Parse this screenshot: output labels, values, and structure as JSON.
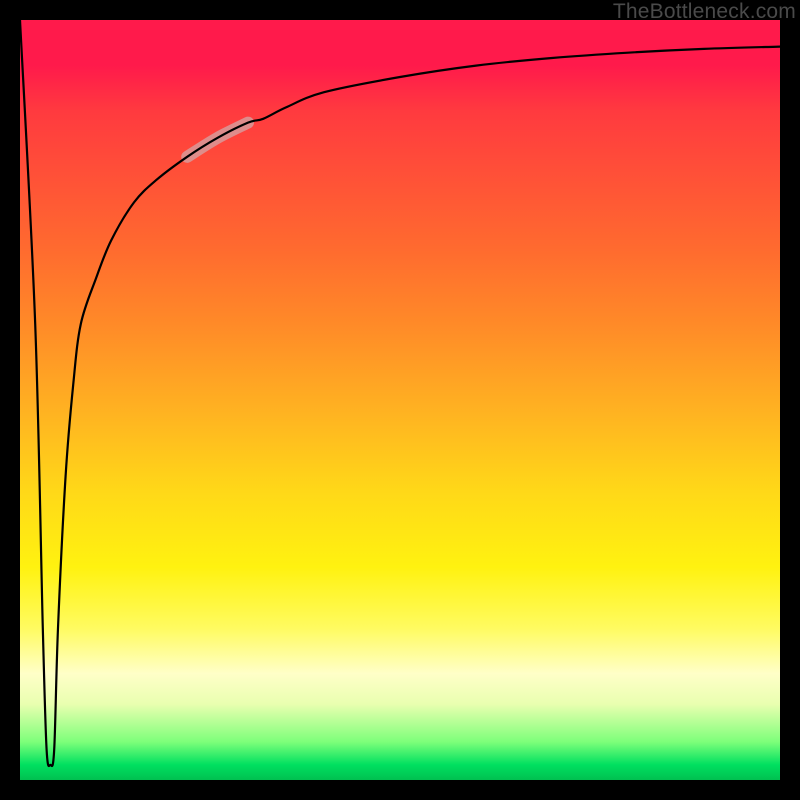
{
  "watermark": "TheBottleneck.com",
  "chart_data": {
    "type": "line",
    "title": "",
    "xlabel": "",
    "ylabel": "",
    "xlim": [
      0,
      100
    ],
    "ylim": [
      0,
      100
    ],
    "grid": false,
    "series": [
      {
        "name": "curve",
        "color": "#000000",
        "x": [
          0,
          2,
          3,
          3.5,
          4,
          4.5,
          5,
          6,
          7,
          8,
          10,
          12,
          15,
          18,
          22,
          26,
          30,
          32,
          35,
          40,
          50,
          60,
          70,
          80,
          90,
          100
        ],
        "y": [
          100,
          60,
          20,
          4,
          2,
          4,
          20,
          40,
          52,
          60,
          66,
          71,
          76,
          79,
          82,
          84.5,
          86.5,
          87,
          88.5,
          90.5,
          92.5,
          94,
          95,
          95.7,
          96.2,
          96.5
        ]
      }
    ],
    "highlight_segment": {
      "on_series": "curve",
      "x_start": 22,
      "x_end": 30,
      "color": "#d89a9a",
      "width": 12
    },
    "background_gradient": {
      "direction": "vertical",
      "stops": [
        {
          "pos": 0.0,
          "color": "#ff1a4b"
        },
        {
          "pos": 0.3,
          "color": "#ff6a2f"
        },
        {
          "pos": 0.55,
          "color": "#ffc81f"
        },
        {
          "pos": 0.75,
          "color": "#fff210"
        },
        {
          "pos": 0.88,
          "color": "#ffffc8"
        },
        {
          "pos": 0.97,
          "color": "#7dff7a"
        },
        {
          "pos": 1.0,
          "color": "#00c050"
        }
      ]
    }
  }
}
